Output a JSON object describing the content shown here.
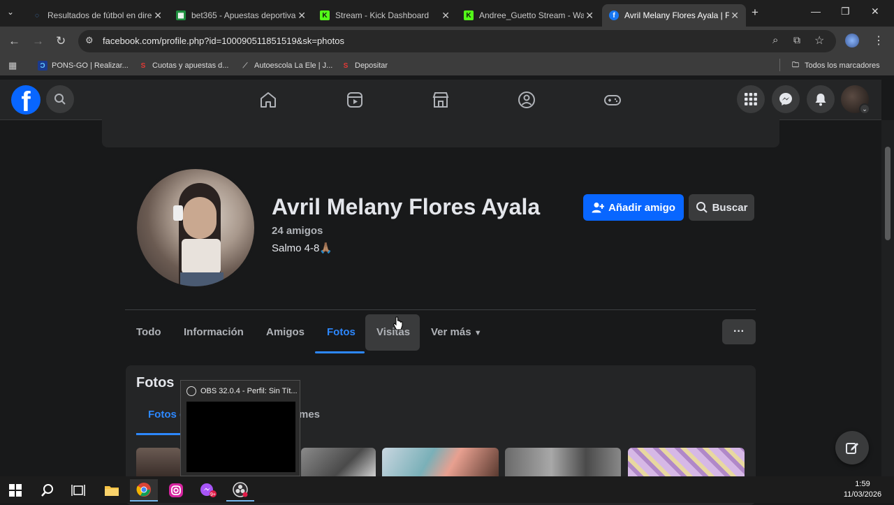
{
  "browser": {
    "tabs": [
      {
        "label": "Resultados de fútbol en dire",
        "favicon": "loading-icon",
        "color": "#4a90e2"
      },
      {
        "label": "bet365 - Apuestas deportiva",
        "favicon": "sheet-icon",
        "color": "#1e8e3e"
      },
      {
        "label": "Stream - Kick Dashboard",
        "favicon": "kick-icon",
        "color": "#53fc18"
      },
      {
        "label": "Andree_Guetto Stream - Wa",
        "favicon": "kick-icon",
        "color": "#53fc18"
      },
      {
        "label": "Avril Melany Flores Ayala | F",
        "favicon": "facebook-icon",
        "color": "#1877f2"
      }
    ],
    "new_tab": "+",
    "url": "facebook.com/profile.php?id=100090511851519&sk=photos",
    "bookmarks": [
      {
        "label": "PONS-GO | Realizar...",
        "icon": "pons-icon"
      },
      {
        "label": "Cuotas y apuestas d...",
        "icon": "sportium-icon"
      },
      {
        "label": "Autoescola La Ele | J...",
        "icon": "autoescola-icon"
      },
      {
        "label": "Depositar",
        "icon": "sportium-icon"
      }
    ],
    "all_bookmarks": "Todos los marcadores"
  },
  "profile": {
    "name": "Avril Melany Flores Ayala",
    "friends": "24 amigos",
    "bio": "Salmo 4-8🙏🏽",
    "add_friend": "Añadir amigo",
    "search": "Buscar",
    "tabs": [
      "Todo",
      "Información",
      "Amigos",
      "Fotos",
      "Visitas",
      "Ver más"
    ],
    "active_tab": "Fotos",
    "more": "···"
  },
  "photos": {
    "heading": "Fotos",
    "subtab_left": "Fotos d",
    "subtab_right": "mes"
  },
  "obs_popup": {
    "title": "OBS 32.0.4 - Perfil: Sin Tít..."
  },
  "taskbar": {
    "time": "1:59",
    "date": "11/03/2026"
  },
  "colors": {
    "accent": "#2d88ff",
    "primary_button": "#0866ff"
  }
}
